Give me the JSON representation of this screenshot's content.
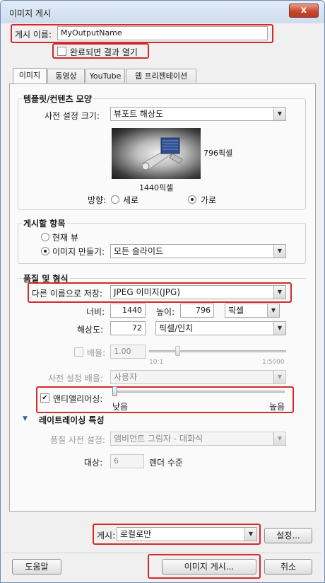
{
  "window": {
    "title": "이미지 게시",
    "close_glyph": "x"
  },
  "publish_name": {
    "label": "게시 이름:",
    "value": "MyOutputName"
  },
  "open_result": {
    "label": "완료되면 결과 열기",
    "checked": false
  },
  "tabs": [
    {
      "label": "이미지",
      "active": true
    },
    {
      "label": "동영상",
      "active": false
    },
    {
      "label": "YouTube",
      "active": false
    },
    {
      "label": "웹 프리젠테이션",
      "active": false
    }
  ],
  "template": {
    "group_title": "템플릿/컨텐츠 모양",
    "preset_size_label": "사전 설정 크기:",
    "preset_size_value": "뷰포트 해상도",
    "height_label": "796픽셀",
    "width_label": "1440픽셀",
    "orientation_label": "방향:",
    "portrait": "세로",
    "landscape": "가로",
    "orientation_selected": "landscape"
  },
  "publish_items": {
    "group_title": "게시할 항목",
    "current_view": "현재 뷰",
    "make_images": "이미지 만들기:",
    "make_images_value": "모든 슬라이드",
    "selected": "make_images"
  },
  "quality": {
    "group_title": "품질 및 형식",
    "save_as_label": "다른 이름으로 저장:",
    "save_as_value": "JPEG 이미지(JPG)",
    "width_label": "너비:",
    "width_value": "1440",
    "height_label": "높이:",
    "height_value": "796",
    "unit_value": "픽셀",
    "resolution_label": "해상도:",
    "resolution_value": "72",
    "resolution_unit": "픽셀/인치",
    "scale_label": "배율:",
    "scale_value": "1.00",
    "scale_min": "10:1",
    "scale_max": "1:5000",
    "preset_scale_label": "사전 설정 배율:",
    "preset_scale_value": "사용자",
    "antialias_label": "앤티앨리어싱:",
    "antialias_checked": true,
    "antialias_low": "낮음",
    "antialias_high": "높음"
  },
  "raytrace": {
    "title": "레이트레이싱 특성",
    "quality_preset_label": "품질 사전 설정:",
    "quality_preset_value": "앰비언트 그림자 - 대화식",
    "target_label": "대상:",
    "target_value": "6",
    "target_suffix": "렌더 수준"
  },
  "publish_to": {
    "label": "게시:",
    "value": "로컬로만",
    "settings_button": "설정..."
  },
  "footer": {
    "help": "도움말",
    "publish": "이미지 게시...",
    "cancel": "취소"
  }
}
